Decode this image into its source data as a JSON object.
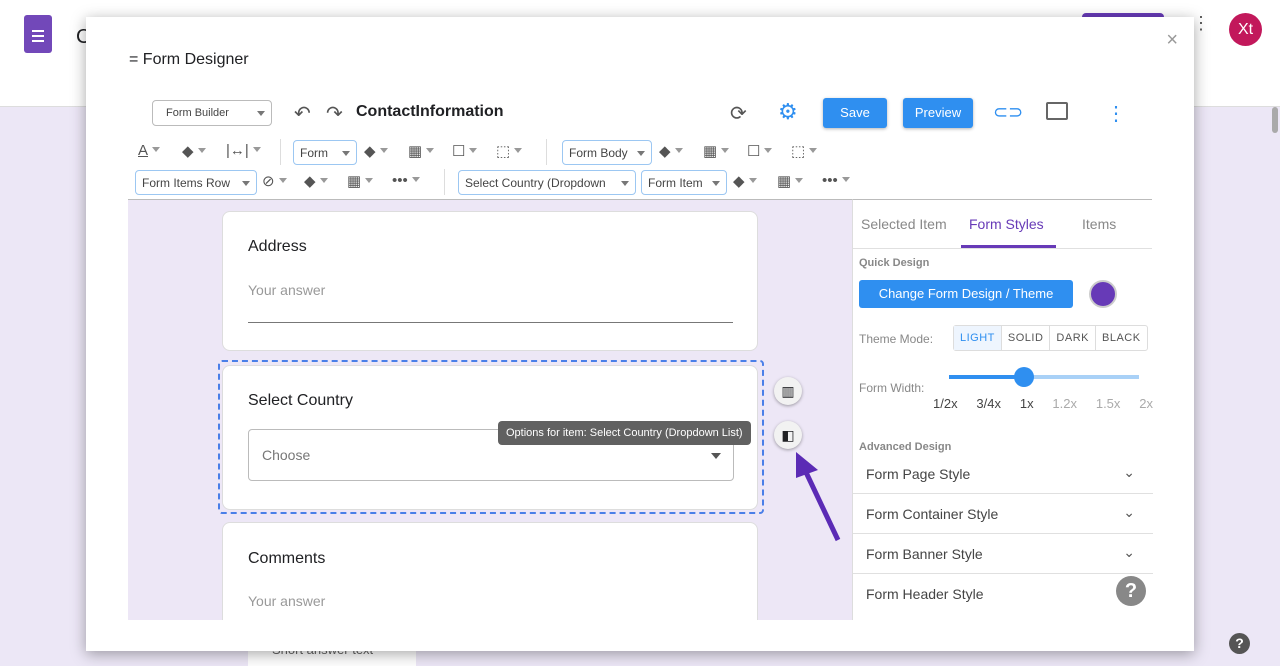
{
  "background": {
    "avatar": "Xt",
    "title_partial": "C",
    "short_answer": "Short answer text",
    "help": "?"
  },
  "modal": {
    "title": "= Form Designer",
    "close": "×",
    "toolbar": {
      "mode_select": "Form Builder",
      "doc_name": "ContactInformation",
      "save": "Save",
      "preview": "Preview",
      "form_select": "Form",
      "form_body_select": "Form Body",
      "form_items_row_select": "Form Items Row",
      "item_select": "Select Country (Dropdown",
      "form_item_select": "Form Item"
    },
    "form": {
      "cards": [
        {
          "question": "Address",
          "placeholder": "Your answer"
        },
        {
          "question": "Select Country",
          "dropdown": "Choose"
        },
        {
          "question": "Comments",
          "placeholder": "Your answer"
        }
      ],
      "tooltip": "Options for item: Select Country (Dropdown List)"
    },
    "panel": {
      "tabs": [
        "Selected Item",
        "Form Styles",
        "Items"
      ],
      "active_tab": "Form Styles",
      "quick_design": "Quick Design",
      "change_theme": "Change Form Design / Theme",
      "theme_color": "#673ab7",
      "theme_mode_label": "Theme Mode:",
      "theme_modes": [
        "LIGHT",
        "SOLID",
        "DARK",
        "BLACK"
      ],
      "theme_mode_selected": "LIGHT",
      "form_width_label": "Form Width:",
      "width_ticks": [
        "1/2x",
        "3/4x",
        "1x",
        "1.2x",
        "1.5x",
        "2x"
      ],
      "form_width_selected": "1x",
      "advanced_design": "Advanced Design",
      "accordions": [
        "Form Page Style",
        "Form Container Style",
        "Form Banner Style",
        "Form Header Style"
      ],
      "help": "?"
    }
  }
}
